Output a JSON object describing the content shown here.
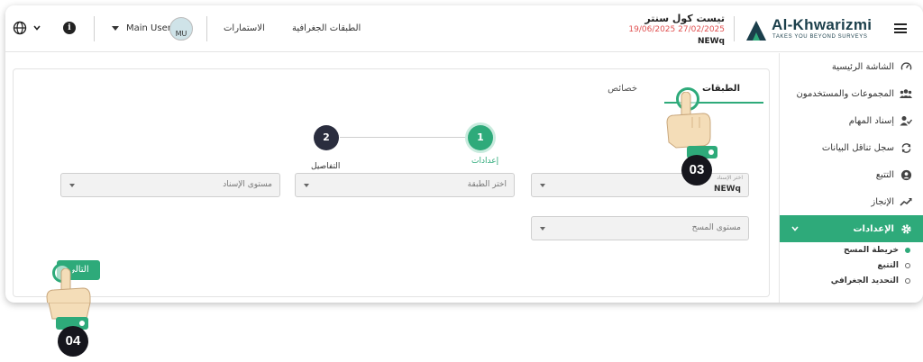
{
  "header": {
    "language_icon": "globe-icon",
    "info_icon": "info-icon",
    "user_name": "Main User",
    "avatar_initials": "MU",
    "nav_forms": "الاستمارات",
    "nav_layers": "الطبقات الجغرافية",
    "project_title": "تيست كول سنتر",
    "project_dates": "19/06/2025 27/02/2025",
    "project_code": "NEWq",
    "logo_title": "Al-Khwarizmi",
    "logo_subtitle": "TAKES YOU BEYOND SURVEYS"
  },
  "sidebar": {
    "items": [
      {
        "label": "الشاشة الرئيسية",
        "icon": "gauge-icon"
      },
      {
        "label": "المجموعات والمستخدمون",
        "icon": "users-icon"
      },
      {
        "label": "إسناد المهام",
        "icon": "user-check-icon"
      },
      {
        "label": "سجل تناقل البيانات",
        "icon": "sync-icon"
      },
      {
        "label": "التتبع",
        "icon": "user-circle-icon"
      },
      {
        "label": "الإنجاز",
        "icon": "trend-icon"
      }
    ],
    "active_item": {
      "label": "الإعدادات",
      "icon": "gear-icon"
    },
    "sub_items": [
      {
        "label": "خريطة المسح"
      },
      {
        "label": "التتبع"
      },
      {
        "label": "التحديد الجغرافي"
      }
    ]
  },
  "tabs": {
    "active": "الطبقات",
    "other": "خصائص"
  },
  "stepper": {
    "step1_number": "1",
    "step1_label": "إعدادات",
    "step2_number": "2",
    "step2_label": "التفاصيل"
  },
  "form": {
    "assign_select_label": "اختر الإسناد",
    "assign_select_value": "NEWq",
    "layer_select_placeholder": "اختر الطبقة",
    "assign_level_placeholder": "مستوى الإسناد",
    "survey_level_placeholder": "مستوى المسح",
    "next_button": "التالي"
  },
  "tutorial": {
    "badge_03": "03",
    "badge_04": "04"
  },
  "colors": {
    "accent": "#2eaa7a",
    "dark": "#2a2d3e",
    "date_red": "#e05050",
    "logo": "#1b3f4b"
  }
}
